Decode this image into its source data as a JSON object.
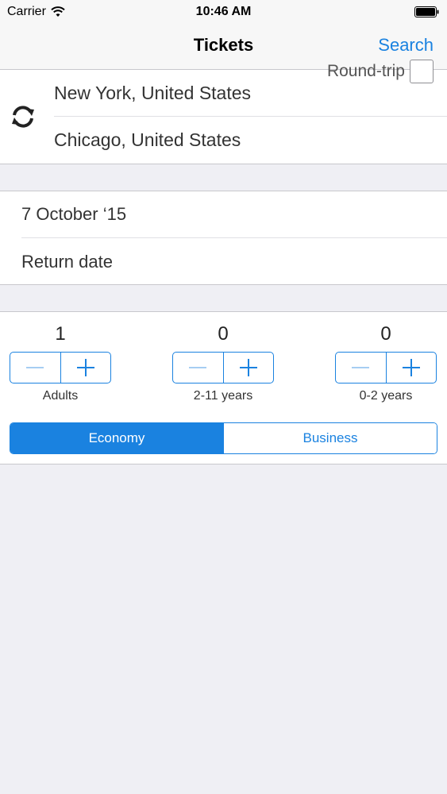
{
  "status_bar": {
    "carrier": "Carrier",
    "time": "10:46 AM"
  },
  "nav": {
    "title": "Tickets",
    "search_label": "Search"
  },
  "route": {
    "from": "New York, United States",
    "to": "Chicago, United States"
  },
  "dates": {
    "departure": "7 October ‘15",
    "return_placeholder": "Return date",
    "round_trip_label": "Round-trip",
    "round_trip_checked": false
  },
  "passengers": [
    {
      "count": "1",
      "label": "Adults"
    },
    {
      "count": "0",
      "label": "2-11 years"
    },
    {
      "count": "0",
      "label": "0-2 years"
    }
  ],
  "cabin": {
    "options": [
      "Economy",
      "Business"
    ],
    "selected": "Economy"
  },
  "colors": {
    "accent": "#1a82e0",
    "background": "#efeff4",
    "bar": "#f7f7f7"
  }
}
